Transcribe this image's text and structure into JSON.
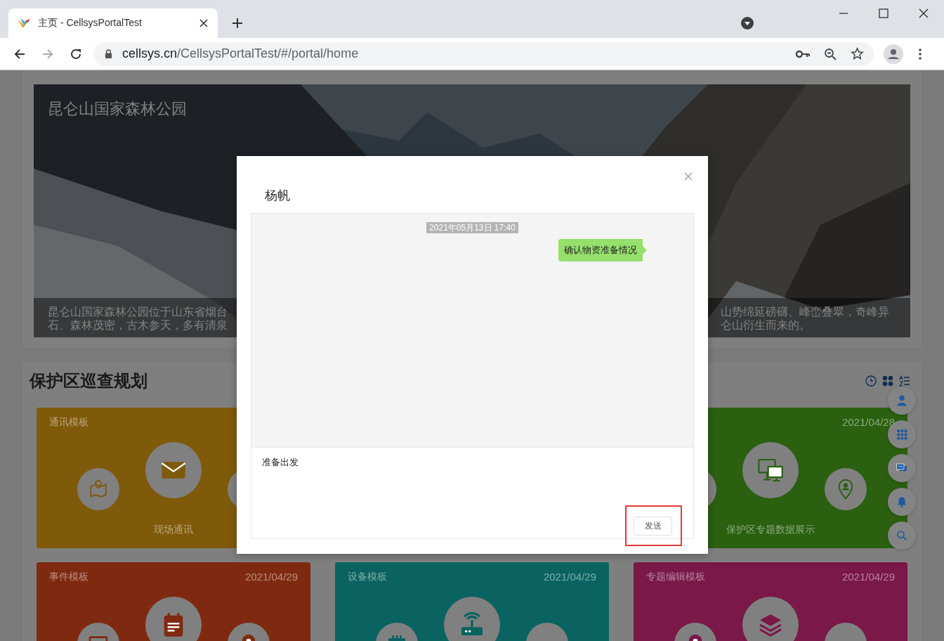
{
  "browser": {
    "tabs": [
      {
        "title": "主页 - CellsysPortalTest",
        "selected": true
      }
    ],
    "address": {
      "host": "cellsys.cn",
      "path": "/CellsysPortalTest/#/portal/home"
    }
  },
  "banner": {
    "title": "昆仑山国家森林公园",
    "caption_left": [
      "昆仑山国家森林公园位于山东省烟台",
      "石、森林茂密，古木参天，多有清泉"
    ],
    "caption_right": [
      "山势绵延磅礴、峰峦叠翠，奇峰异",
      "仑山衍生而来的。"
    ]
  },
  "section": {
    "title": "保护区巡查规划",
    "card_rows": [
      [
        {
          "header": "通讯模板",
          "label": "现场通讯",
          "color": "#7f5a0b"
        },
        null,
        {
          "date": "2021/04/28",
          "label": "保护区专题数据展示",
          "color": "#2a600f"
        }
      ],
      [
        {
          "header": "事件模板",
          "date": "2021/04/29",
          "color": "#7f2a10"
        },
        {
          "header": "设备模板",
          "date": "2021/04/29",
          "color": "#0a6360"
        },
        {
          "header": "专题编辑模板",
          "date": "2021/04/29",
          "color": "#7a1848"
        }
      ]
    ]
  },
  "dialog": {
    "title": "杨帆",
    "messages": [
      {
        "kind": "time",
        "text": "2021年05月13日 17:40"
      },
      {
        "kind": "sent",
        "text": "确认物资准备情况"
      }
    ],
    "input": {
      "value": "准备出发"
    },
    "send_button": {
      "label": "发送",
      "highlighted": true
    }
  }
}
